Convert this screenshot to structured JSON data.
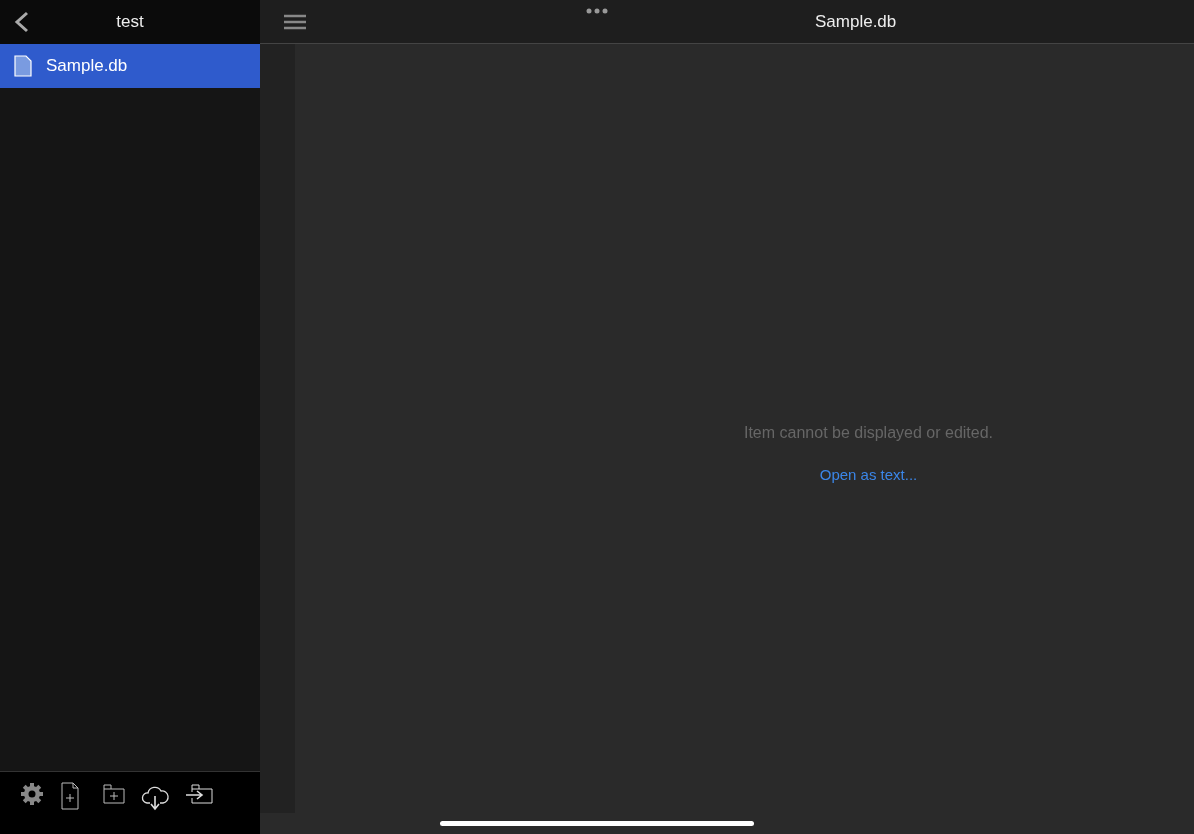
{
  "sidebar": {
    "title": "test",
    "files": [
      {
        "name": "Sample.db",
        "selected": true
      }
    ]
  },
  "editor": {
    "title": "Sample.db",
    "message": "Item cannot be displayed or edited.",
    "link": "Open as text..."
  }
}
